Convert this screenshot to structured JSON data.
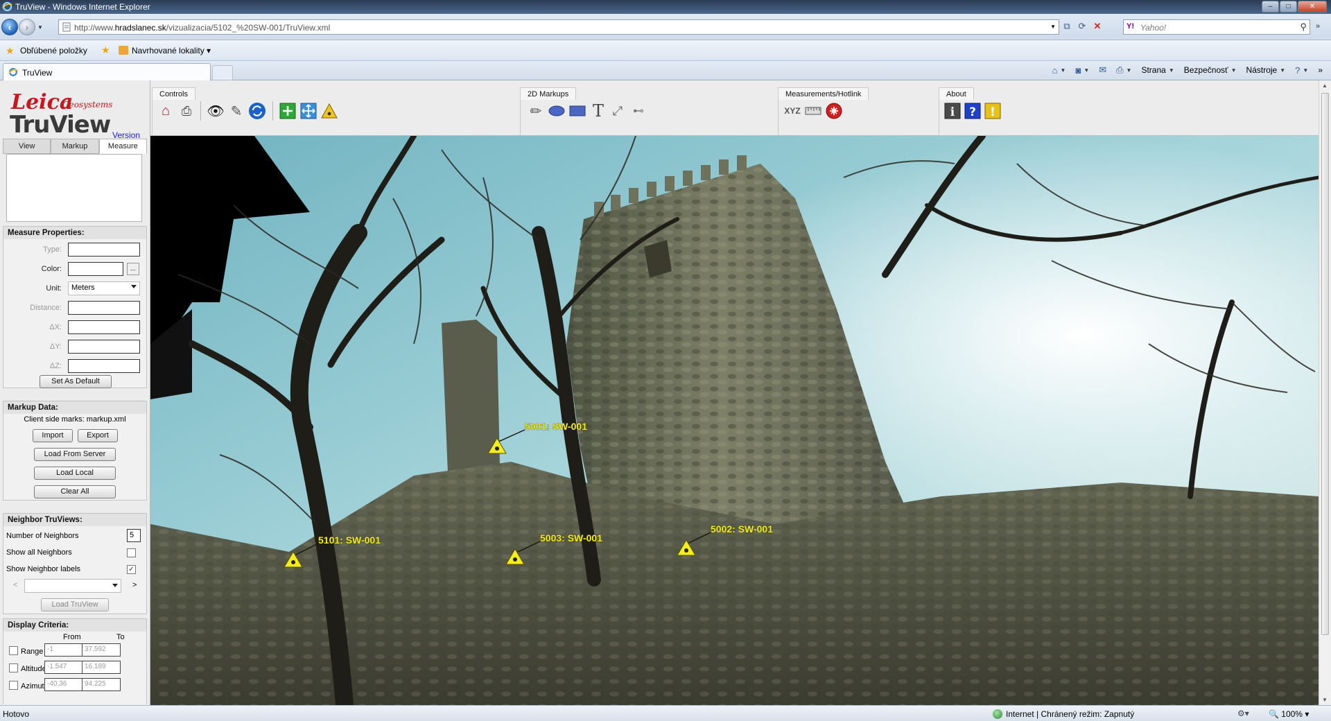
{
  "window": {
    "title": "TruView - Windows Internet Explorer",
    "min": "–",
    "max": "□",
    "close": "✕"
  },
  "address": {
    "url_prefix": "http://www.",
    "url_domain": "hradslanec.sk",
    "url_path": "/vizualizacia/5102_%20SW-001/TruView.xml",
    "search_placeholder": "Yahoo!",
    "search_brand": "Y!"
  },
  "favorites": {
    "label": "Obľúbené položky",
    "suggested": "Navrhované lokality"
  },
  "tab": {
    "label": "TruView"
  },
  "commands": {
    "page": "Strana",
    "safety": "Bezpečnosť",
    "tools": "Nástroje"
  },
  "left_panel": {
    "logo_leica": "Leica",
    "logo_geosystems": "Geosystems",
    "logo_truview": "TruView",
    "version_link": "Version",
    "tabs": [
      "View",
      "Markup",
      "Measure"
    ],
    "measure_properties": {
      "title": "Measure Properties:",
      "type_label": "Type:",
      "color_label": "Color:",
      "color_picker": "...",
      "unit_label": "Unit:",
      "unit_value": "Meters",
      "distance_label": "Distance:",
      "dx_label": "ΔX:",
      "dy_label": "ΔY:",
      "dz_label": "ΔZ:",
      "set_default": "Set As Default"
    },
    "markup_data": {
      "title": "Markup Data:",
      "client_marks": "Client side marks: markup.xml",
      "import": "Import",
      "export": "Export",
      "load_server": "Load From Server",
      "load_local": "Load Local",
      "clear_all": "Clear All"
    },
    "neighbors": {
      "title": "Neighbor TruViews:",
      "count_label": "Number of Neighbors",
      "count_value": "5",
      "show_all": "Show all Neighbors",
      "show_all_checked": false,
      "show_labels": "Show Neighbor labels",
      "show_labels_checked": true,
      "prev": "<",
      "next": ">",
      "load": "Load TruView"
    },
    "display_criteria": {
      "title": "Display Criteria:",
      "from": "From",
      "to": "To",
      "rows": [
        {
          "label": "Range",
          "from": "-1",
          "to": "37.592"
        },
        {
          "label": "Altitude",
          "from": "-1.547",
          "to": "16.189"
        },
        {
          "label": "Azimuth",
          "from": "-40.36",
          "to": "94.225"
        }
      ]
    }
  },
  "toolbar": {
    "controls": "Controls",
    "markups": "2D Markups",
    "measurements": "Measurements/Hotlink",
    "about": "About",
    "xyz": "XYZ"
  },
  "markers": [
    {
      "label": "5001: SW-001"
    },
    {
      "label": "5002: SW-001"
    },
    {
      "label": "5003: SW-001"
    },
    {
      "label": "5101: SW-001"
    }
  ],
  "status": {
    "text": "Hotovo",
    "zone": "Internet | Chránený režim: Zapnutý",
    "zoom": "100%"
  },
  "colors": {
    "marker": "#f4ee1b",
    "leica_red": "#c8171e",
    "link": "#1a1ae0"
  }
}
